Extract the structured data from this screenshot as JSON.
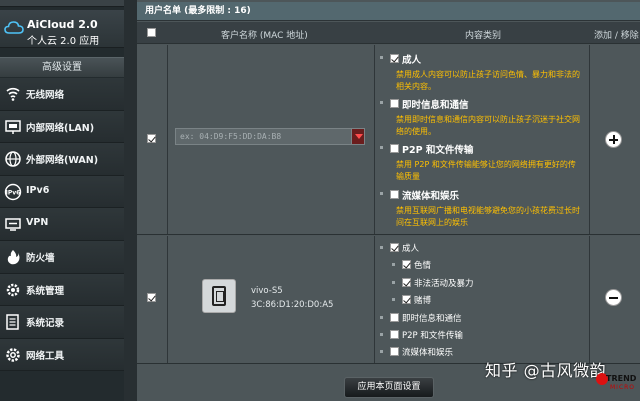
{
  "sidebar": {
    "aicloud_title": "AiCloud 2.0",
    "aicloud_subtitle": "个人云 2.0 应用",
    "section_title": "高级设置",
    "items": [
      {
        "label": "无线网络",
        "icon": "wifi-icon"
      },
      {
        "label": "内部网络(LAN)",
        "icon": "lan-icon"
      },
      {
        "label": "外部网络(WAN)",
        "icon": "globe-icon"
      },
      {
        "label": "IPv6",
        "icon": "ipv6-icon"
      },
      {
        "label": "VPN",
        "icon": "vpn-icon"
      },
      {
        "label": "防火墙",
        "icon": "firewall-icon"
      },
      {
        "label": "系统管理",
        "icon": "gear-icon"
      },
      {
        "label": "系统记录",
        "icon": "log-icon"
      },
      {
        "label": "网络工具",
        "icon": "tools-icon"
      }
    ]
  },
  "panel": {
    "list_title": "用户名单 (最多限制 : 16)",
    "columns": {
      "client": "客户名称 (MAC 地址)",
      "category": "内容类别",
      "action": "添加 / 移除"
    },
    "row1": {
      "mac_placeholder": "ex: 04:D9:F5:DD:DA:B8",
      "categories": [
        {
          "title": "成人",
          "checked": true,
          "desc": "禁用成人内容可以防止孩子访问色情、暴力和非法的相关内容。"
        },
        {
          "title": "即时信息和通信",
          "checked": false,
          "desc": "禁用即时信息和通信内容可以防止孩子沉迷于社交网络的使用。"
        },
        {
          "title": "P2P 和文件传输",
          "checked": false,
          "desc": "禁用 P2P 和文件传输能够让您的网络拥有更好的传输质量"
        },
        {
          "title": "流媒体和娱乐",
          "checked": false,
          "desc": "禁用互联网广播和电视能够避免您的小孩花费过长时间在互联网上的娱乐"
        }
      ]
    },
    "row2": {
      "device_name": "vivo-S5",
      "device_mac": "3C:86:D1:20:D0:A5",
      "categories": [
        {
          "title": "成人",
          "checked": true,
          "level": 1
        },
        {
          "title": "色情",
          "checked": true,
          "level": 2
        },
        {
          "title": "非法活动及暴力",
          "checked": true,
          "level": 2
        },
        {
          "title": "赌博",
          "checked": true,
          "level": 2
        },
        {
          "title": "即时信息和通信",
          "checked": false,
          "level": 1
        },
        {
          "title": "P2P 和文件传输",
          "checked": false,
          "level": 1
        },
        {
          "title": "流媒体和娱乐",
          "checked": false,
          "level": 1
        }
      ]
    },
    "apply_label": "应用本页面设置"
  },
  "watermark": "知乎 @古风微韵",
  "trend_logo": {
    "name": "TREND",
    "sub": "MICRO"
  },
  "colors": {
    "desc_text": "#ffc000",
    "accent_red": "#ff4d4d"
  }
}
